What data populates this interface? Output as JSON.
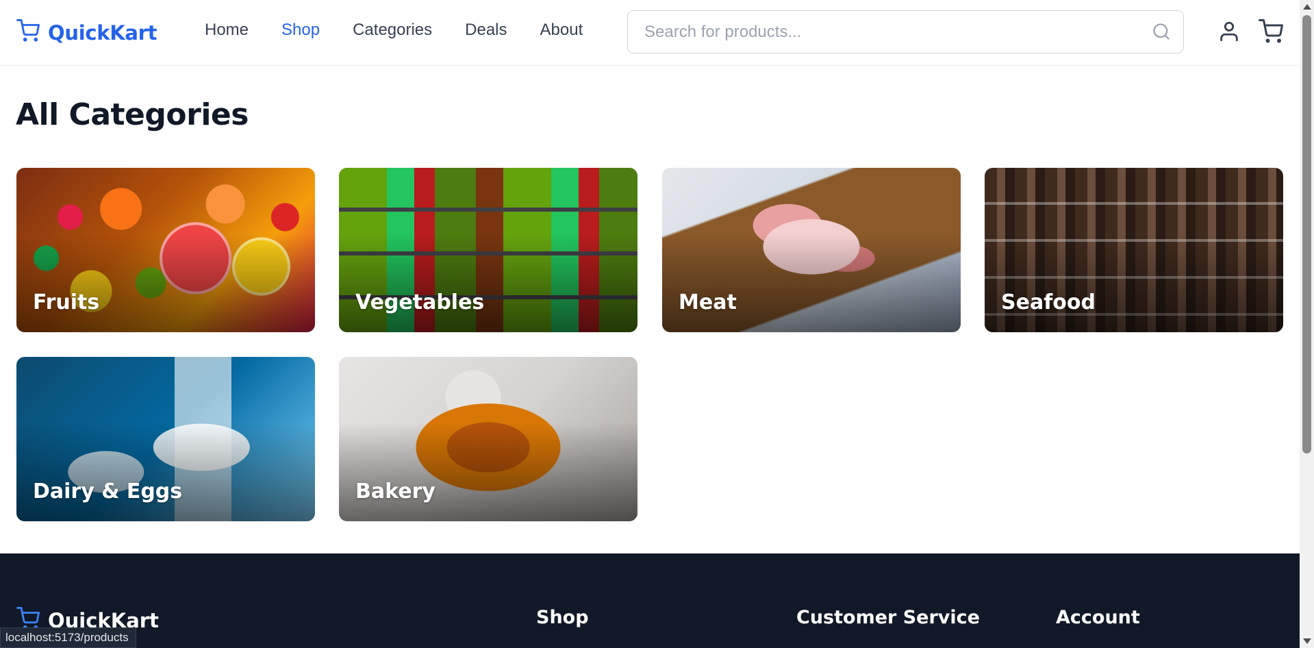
{
  "header": {
    "brand": "QuickKart",
    "nav": [
      {
        "label": "Home"
      },
      {
        "label": "Shop"
      },
      {
        "label": "Categories"
      },
      {
        "label": "Deals"
      },
      {
        "label": "About"
      }
    ],
    "active_nav": "Shop",
    "search_placeholder": "Search for products...",
    "icons": {
      "search": "search-icon",
      "user": "user-icon",
      "cart": "cart-icon",
      "logo": "cart-icon"
    }
  },
  "main": {
    "title": "All Categories",
    "categories": [
      {
        "label": "Fruits"
      },
      {
        "label": "Vegetables"
      },
      {
        "label": "Meat"
      },
      {
        "label": "Seafood"
      },
      {
        "label": "Dairy & Eggs"
      },
      {
        "label": "Bakery"
      }
    ]
  },
  "footer": {
    "brand": "QuickKart",
    "headings": [
      "Shop",
      "Customer Service",
      "Account"
    ]
  },
  "status_bar": {
    "url": "localhost:5173/products"
  },
  "colors": {
    "accent": "#2563eb",
    "footer_bg": "#111827",
    "text": "#111827"
  }
}
